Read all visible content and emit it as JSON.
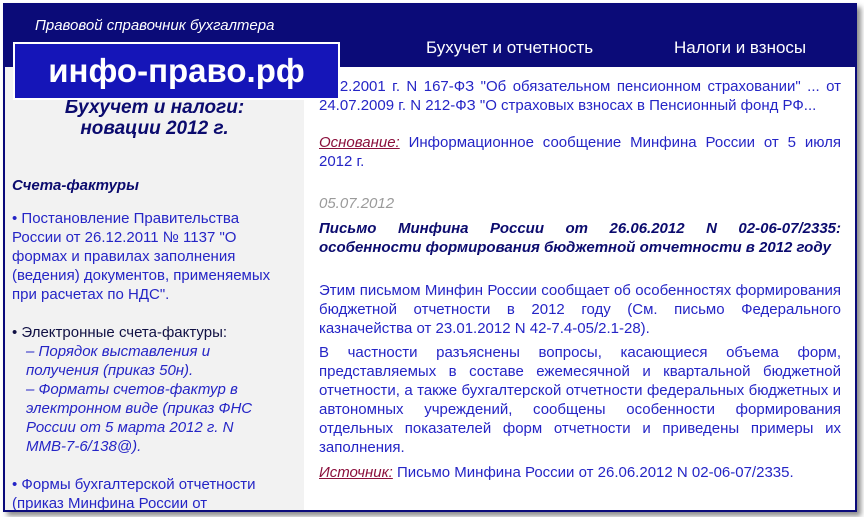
{
  "header": {
    "tagline": "Правовой справочник бухгалтера",
    "logo": "инфо-право.рф",
    "nav": [
      "Бухучет и отчетность",
      "Налоги и взносы"
    ]
  },
  "sidebar": {
    "title_line1": "Бухучет и налоги:",
    "title_line2": "новации 2012 г.",
    "section_heading": "Счета-фактуры",
    "item1": "• Постановление Правительства России от 26.12.2011 № 1137 \"О формах и правилах заполнения (ведения) документов, применяемых при расчетах по НДС\".",
    "item2_label": "• Электронные счета-фактуры:",
    "item2_sub1": "– Порядок выставления и получения (приказ 50н).",
    "item2_sub2": "– Форматы счетов-фактур в электронном виде (приказ ФНС России от 5 марта 2012 г. N ММВ-7-6/138@).",
    "item3": "• Формы бухгалтерской отчетности (приказ Минфина России от"
  },
  "main": {
    "top_fragment": "...12.2001 г. N 167-ФЗ \"Об обязательном пенсионном страховании\" ... от 24.07.2009 г. N 212-ФЗ \"О страховых взносах в Пенсионный фонд РФ...",
    "basis_label": "Основание:",
    "basis_text": " Информационное сообщение Минфина России от 5 июля 2012 г.",
    "date": "05.07.2012",
    "article_title": "Письмо Минфина России от 26.06.2012 N 02-06-07/2335: особенности формирования бюджетной отчетности в 2012 году",
    "para1": "Этим письмом Минфин России сообщает об особенностях формирования бюджетной отчетности в 2012 году (См. письмо Федерального казначейства от 23.01.2012 N 42-7.4-05/2.1-28).",
    "para2": "В частности разъяснены вопросы, касающиеся объема форм, представляемых в составе ежемесячной и квартальной бюджетной отчетности, а также бухгалтерской отчетности федеральных бюджетных и автономных учреждений, сообщены особенности формирования отдельных показателей форм отчетности и приведены примеры их заполнения.",
    "source_label": "Источник:",
    "source_text": " Письмо Минфина России от 26.06.2012 N 02-06-07/2335."
  }
}
